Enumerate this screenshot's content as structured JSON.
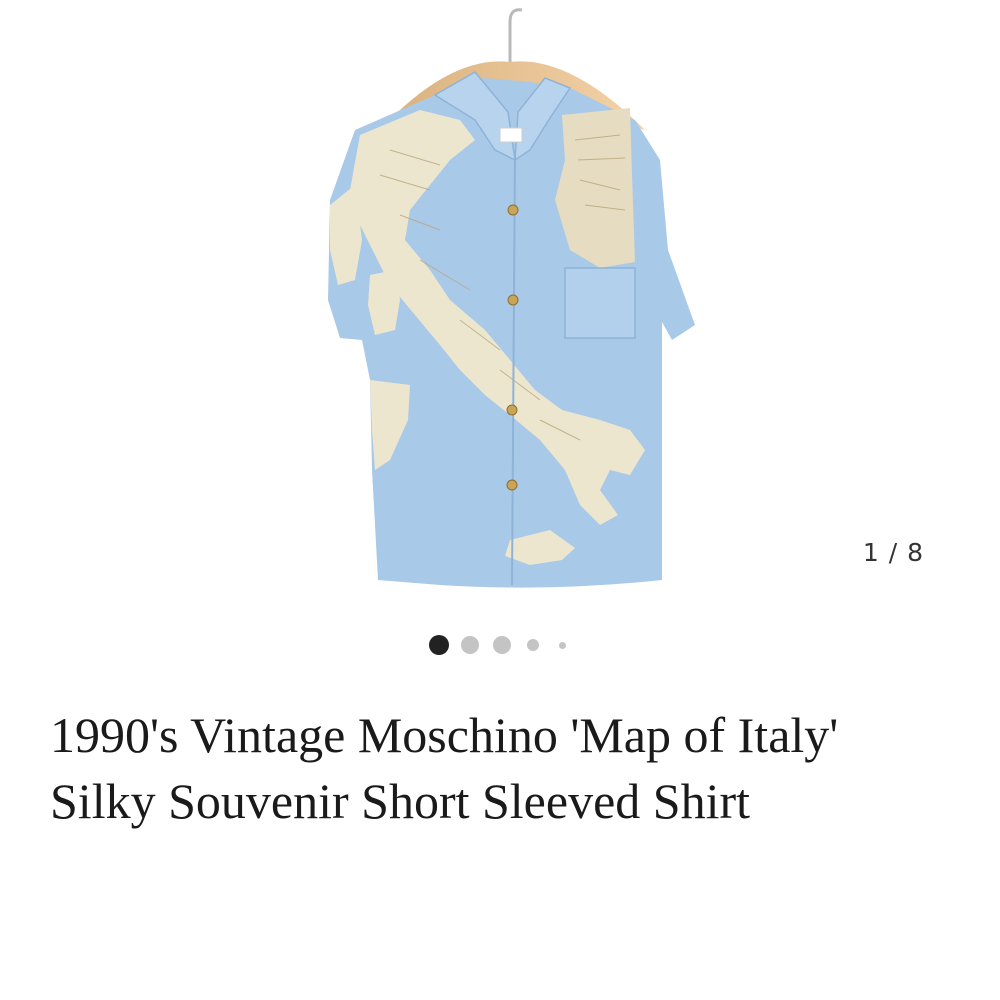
{
  "carousel": {
    "counter": "1 / 8",
    "active_index": 0,
    "dot_count": 5,
    "image_alt": "Blue short sleeved shirt with map of Italy print"
  },
  "product": {
    "title": "1990's Vintage Moschino 'Map of Italy' Silky Souvenir Short Sleeved Shirt"
  },
  "colors": {
    "shirt_blue": "#a9c9e8",
    "map_cream": "#ece6cf",
    "dot_active": "#222222",
    "dot_inactive": "#c4c4c4"
  }
}
